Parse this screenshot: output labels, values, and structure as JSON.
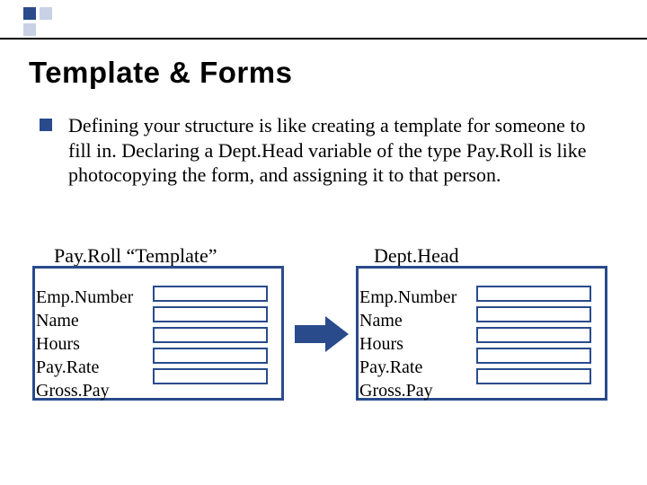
{
  "title": "Template & Forms",
  "bullet": "Defining your structure is like creating a template for someone to fill in. Declaring a Dept.Head variable of the type Pay.Roll is like photocopying the form, and assigning it to that person.",
  "forms": {
    "left": {
      "title": "Pay.Roll “Template”",
      "fields": [
        "Emp.Number",
        "Name",
        "Hours",
        "Pay.Rate",
        "Gross.Pay"
      ]
    },
    "right": {
      "title": "Dept.Head",
      "fields": [
        "Emp.Number",
        "Name",
        "Hours",
        "Pay.Rate",
        "Gross.Pay"
      ]
    }
  }
}
